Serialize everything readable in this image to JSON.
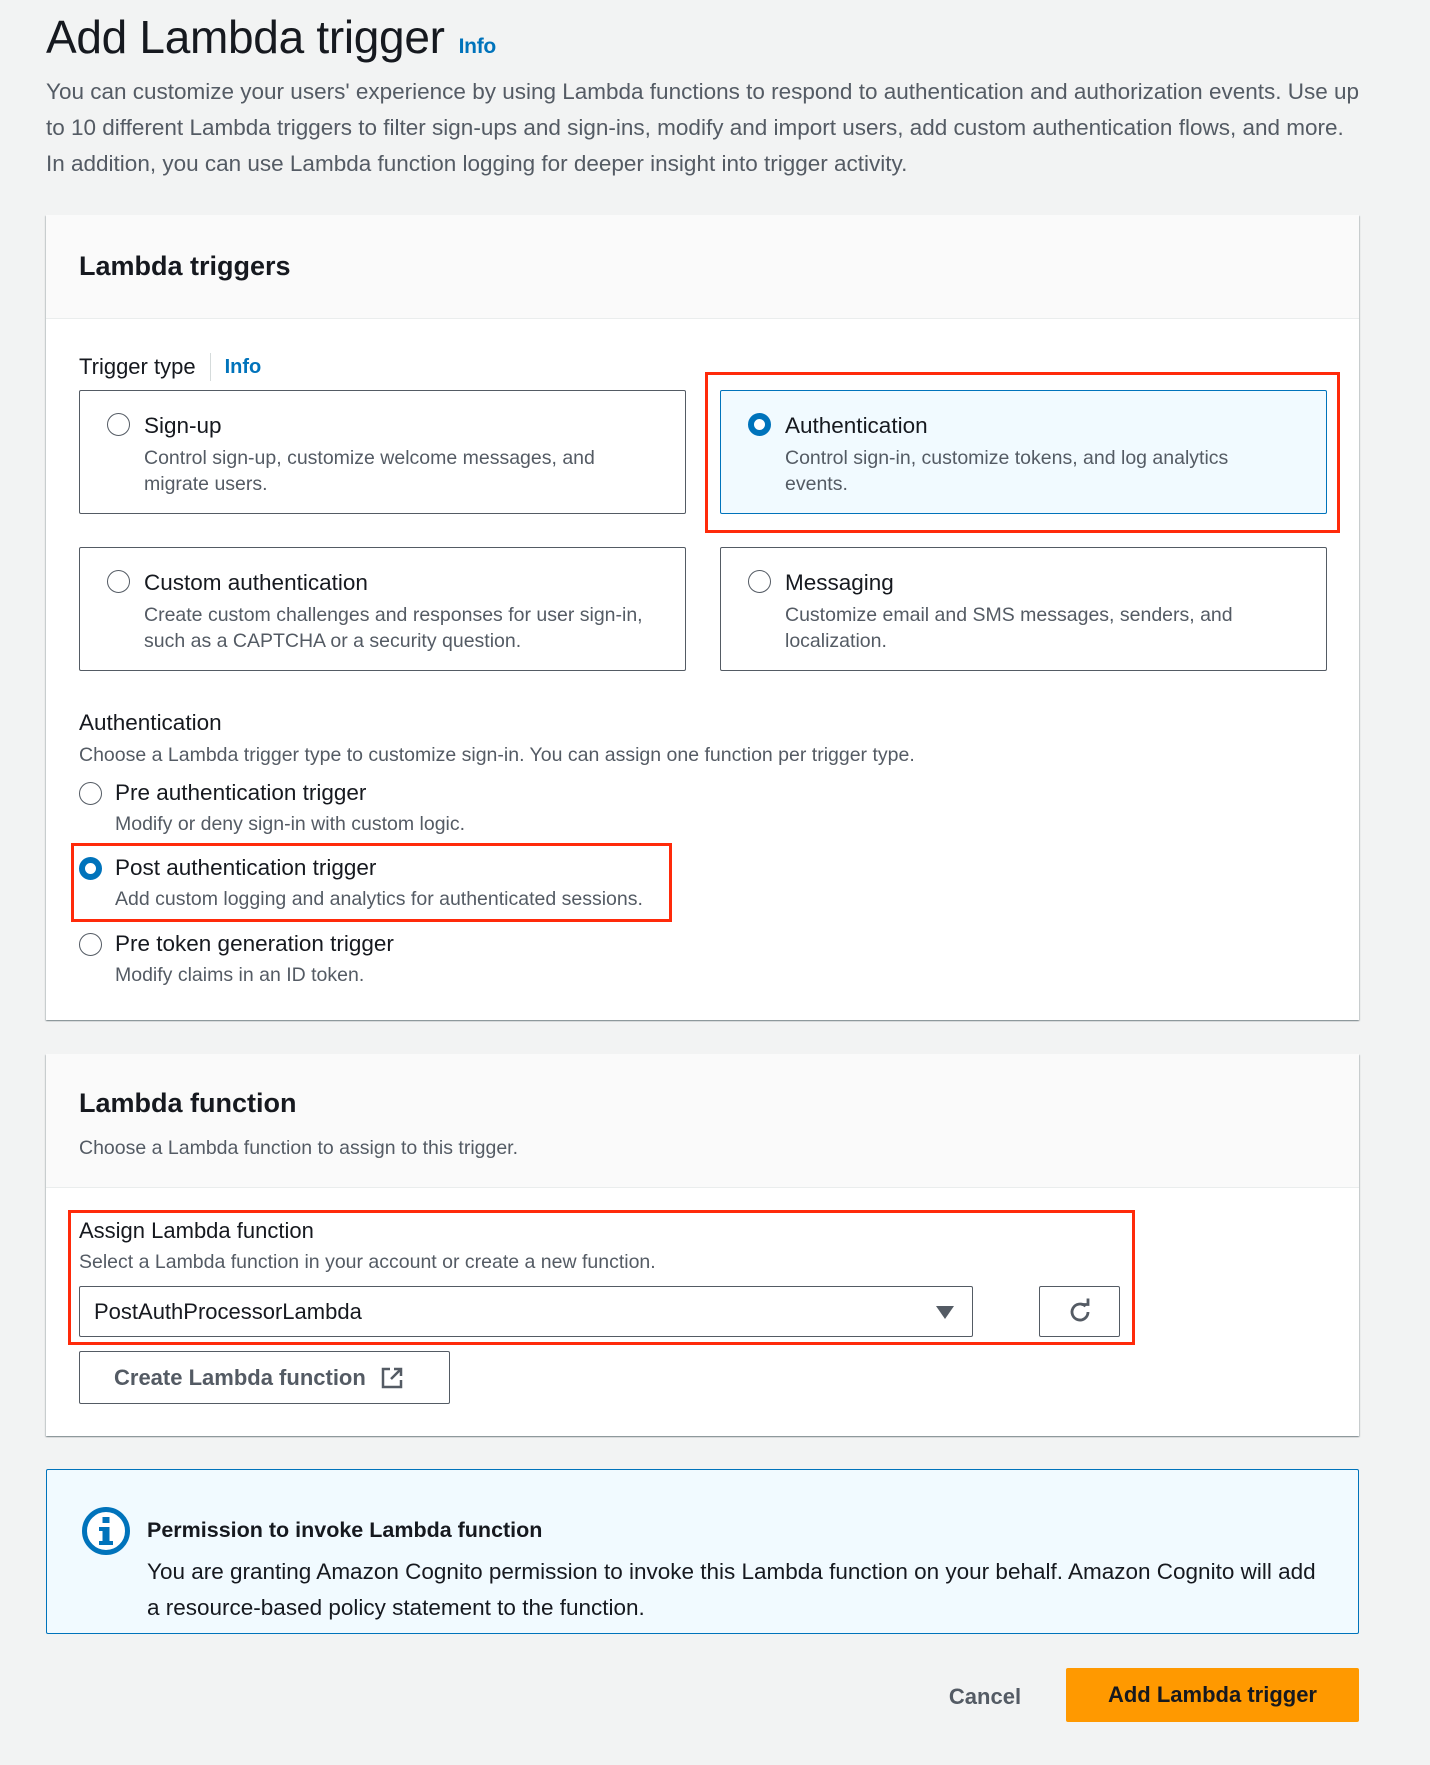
{
  "page": {
    "title": "Add Lambda trigger",
    "info_label": "Info",
    "description": "You can customize your users' experience by using Lambda functions to respond to authentication and authorization events. Use up to 10 different Lambda triggers to filter sign-ups and sign-ins, modify and import users, add custom authentication flows, and more. In addition, you can use Lambda function logging for deeper insight into trigger activity."
  },
  "triggers_panel": {
    "title": "Lambda triggers",
    "trigger_type_label": "Trigger type",
    "trigger_type_info": "Info",
    "selected_trigger_type": "Authentication",
    "tiles": [
      {
        "title": "Sign-up",
        "description": "Control sign-up, customize welcome messages, and migrate users.",
        "selected": false
      },
      {
        "title": "Authentication",
        "description": "Control sign-in, customize tokens, and log analytics events.",
        "selected": true
      },
      {
        "title": "Custom authentication",
        "description": "Create custom challenges and responses for user sign-in, such as a CAPTCHA or a security question.",
        "selected": false
      },
      {
        "title": "Messaging",
        "description": "Customize email and SMS messages, senders, and localization.",
        "selected": false
      }
    ],
    "auth_section": {
      "title": "Authentication",
      "description": "Choose a Lambda trigger type to customize sign-in. You can assign one function per trigger type.",
      "selected_option": "Post authentication trigger",
      "options": [
        {
          "title": "Pre authentication trigger",
          "description": "Modify or deny sign-in with custom logic.",
          "selected": false
        },
        {
          "title": "Post authentication trigger",
          "description": "Add custom logging and analytics for authenticated sessions.",
          "selected": true
        },
        {
          "title": "Pre token generation trigger",
          "description": "Modify claims in an ID token.",
          "selected": false
        }
      ]
    }
  },
  "function_panel": {
    "title": "Lambda function",
    "description": "Choose a Lambda function to assign to this trigger.",
    "assign_label": "Assign Lambda function",
    "assign_description": "Select a Lambda function in your account or create a new function.",
    "selected_function": "PostAuthProcessorLambda",
    "refresh_icon": "refresh-icon",
    "create_button_label": "Create Lambda function",
    "create_button_icon": "external-link-icon"
  },
  "alert": {
    "icon": "info-circle-icon",
    "title": "Permission to invoke Lambda function",
    "body": "You are granting Amazon Cognito permission to invoke this Lambda function on your behalf. Amazon Cognito will add a resource-based policy statement to the function."
  },
  "actions": {
    "cancel_label": "Cancel",
    "primary_label": "Add Lambda trigger"
  },
  "colors": {
    "accent": "#0073bb",
    "primary_button": "#ff9900",
    "annotation": "#ff2a0a",
    "background": "#f2f3f3"
  }
}
